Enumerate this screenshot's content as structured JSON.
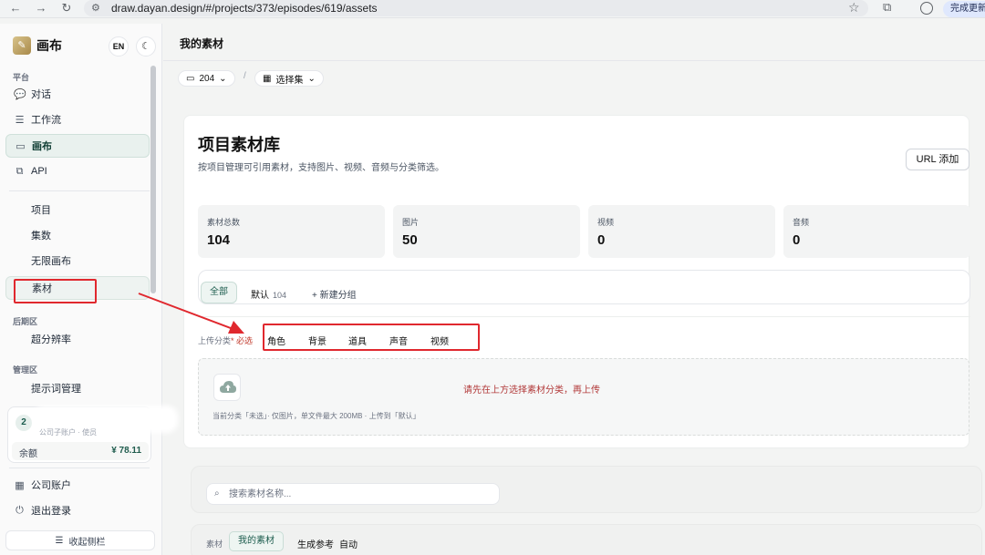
{
  "browser": {
    "url": "draw.dayan.design/#/projects/373/episodes/619/assets",
    "update_label": "完成更新"
  },
  "sidebar": {
    "logo_text": "画布",
    "lang_label": "EN",
    "platform_label": "平台",
    "platform_items": [
      {
        "label": "对话",
        "icon": "chat-icon"
      },
      {
        "label": "工作流",
        "icon": "sliders-icon"
      },
      {
        "label": "画布",
        "icon": "canvas-icon"
      },
      {
        "label": "API",
        "icon": "api-icon"
      }
    ],
    "sub_items": [
      "项目",
      "集数",
      "无限画布",
      "素材"
    ],
    "post_label": "后期区",
    "post_items": [
      "超分辨率"
    ],
    "manage_label": "管理区",
    "manage_items": [
      "提示词管理"
    ],
    "account": {
      "avatar": "2",
      "subtitle": "公司子账户 · 使员",
      "balance_label": "余额",
      "balance_value": "¥ 78.11"
    },
    "footer_items": [
      {
        "label": "公司账户",
        "icon": "building-icon"
      },
      {
        "label": "退出登录",
        "icon": "power-icon"
      }
    ],
    "collapse_label": "收起侧栏"
  },
  "main": {
    "page_title": "我的素材",
    "crumb_project": "204",
    "crumb_episode": "选择集",
    "library_title": "项目素材库",
    "library_desc": "按项目管理可引用素材，支持图片、视频、音频与分类筛选。",
    "url_add_label": "URL 添加",
    "stats": [
      {
        "label": "素材总数",
        "value": "104"
      },
      {
        "label": "图片",
        "value": "50"
      },
      {
        "label": "视频",
        "value": "0"
      },
      {
        "label": "音频",
        "value": "0"
      }
    ],
    "groups": {
      "all": "全部",
      "default": "默认",
      "default_count": "104",
      "new_group": "+ 新建分组"
    },
    "upload_category_label": "上传分类",
    "required_label": "* 必选",
    "categories": [
      "角色",
      "背景",
      "道具",
      "声音",
      "视频"
    ],
    "upload_msg": "请先在上方选择素材分类，再上传",
    "upload_hint": "当前分类「未选」· 仅图片，单文件最大 200MB · 上传到「默认」",
    "search_placeholder": "搜索素材名称...",
    "filter_label": "素材",
    "filter_active": "我的素材",
    "filter_options": [
      "生成参考",
      "自动"
    ]
  },
  "colors": {
    "accent": "#1a5b4c",
    "annotation": "#e0282e"
  }
}
